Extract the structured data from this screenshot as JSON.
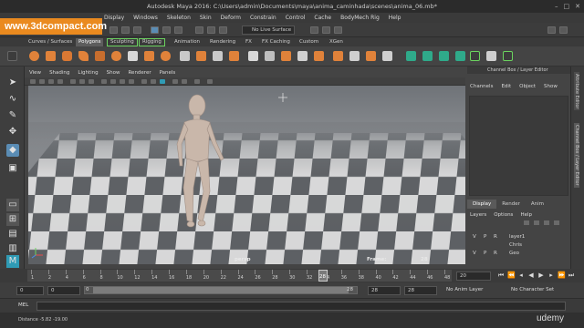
{
  "watermark": "www.3dcompact.com",
  "window": {
    "title": "Autodesk Maya 2016: C:\\Users\\admin\\Documents\\maya\\anima_caminhada\\scenes\\anima_06.mb*"
  },
  "menubar": [
    "Display",
    "Windows",
    "Skeleton",
    "Skin",
    "Deform",
    "Constrain",
    "Control",
    "Cache",
    "BodyMech Rig",
    "Help"
  ],
  "statusline": {
    "live_surface": "No Live Surface"
  },
  "shelf_tabs": [
    {
      "label": "Curves / Surfaces"
    },
    {
      "label": "Polygons"
    },
    {
      "label": "Sculpting"
    },
    {
      "label": "Rigging"
    },
    {
      "label": "Animation"
    },
    {
      "label": "Rendering"
    },
    {
      "label": "FX"
    },
    {
      "label": "FX Caching"
    },
    {
      "label": "Custom"
    },
    {
      "label": "XGen"
    }
  ],
  "panel_menu": [
    "View",
    "Shading",
    "Lighting",
    "Show",
    "Renderer",
    "Panels"
  ],
  "viewport": {
    "camera": "persp",
    "frame_label": "Frame:",
    "frame_value": "28"
  },
  "channel_box": {
    "title": "Channel Box / Layer Editor",
    "menu": [
      "Channels",
      "Edit",
      "Object",
      "Show"
    ]
  },
  "right_tabs": [
    "Attribute Editor",
    "Channel Box / Layer Editor"
  ],
  "layer_editor": {
    "tabs": [
      "Display",
      "Render",
      "Anim"
    ],
    "menu": [
      "Layers",
      "Options",
      "Help"
    ],
    "layers": [
      {
        "v": "V",
        "p": "P",
        "r": "R",
        "name": "layer1"
      },
      {
        "v": "V",
        "p": "P",
        "r": "R",
        "name": "Chris"
      },
      {
        "v": "V",
        "p": "P",
        "r": "R",
        "name": "Geo"
      }
    ]
  },
  "timeline": {
    "ticks": [
      "1",
      "2",
      "4",
      "6",
      "8",
      "10",
      "12",
      "14",
      "16",
      "18",
      "20",
      "22",
      "24",
      "26",
      "28",
      "30",
      "32",
      "34",
      "36",
      "38",
      "40",
      "42",
      "44",
      "46",
      "48"
    ],
    "current_frame_marker": "28",
    "current_frame_field": "20"
  },
  "range": {
    "start": "0",
    "inner_start": "0",
    "bar_value": "0",
    "inner_end": "28",
    "end_a": "28",
    "end_b": "28",
    "anim_layer": "No Anim Layer",
    "character_set": "No Character Set"
  },
  "command_line": {
    "label": "MEL"
  },
  "help_line": {
    "text": "Distance  -5.82       -19.00"
  },
  "brand": "udemy"
}
